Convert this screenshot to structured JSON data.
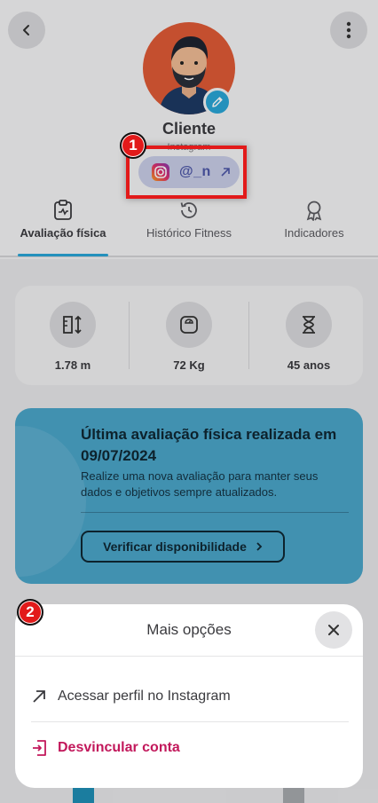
{
  "profile": {
    "name": "Cliente",
    "instagram_caption": "Instagram",
    "instagram_handle": "@_n"
  },
  "tabs": [
    {
      "label": "Avaliação física",
      "icon": "clipboard-icon",
      "active": true
    },
    {
      "label": "Histórico Fitness",
      "icon": "history-icon",
      "active": false
    },
    {
      "label": "Indicadores",
      "icon": "award-icon",
      "active": false
    }
  ],
  "stats": [
    {
      "value": "1.78 m",
      "icon": "height-icon"
    },
    {
      "value": "72 Kg",
      "icon": "scale-icon"
    },
    {
      "value": "45 anos",
      "icon": "hourglass-icon"
    }
  ],
  "evaluation": {
    "title": "Última avaliação física realizada em  09/07/2024",
    "description": "Realize uma nova avaliação para manter seus dados e objetivos sempre atualizados.",
    "button_label": "Verificar disponibilidade"
  },
  "annotations": {
    "marker_1": "1",
    "marker_2": "2"
  },
  "sheet": {
    "title": "Mais opções",
    "items": [
      {
        "label": "Acessar perfil no Instagram",
        "icon": "arrow-up-right-icon"
      },
      {
        "label": "Desvincular conta",
        "icon": "logout-icon"
      }
    ]
  },
  "colors": {
    "accent": "#2aa5d6",
    "danger": "#c2185b",
    "annotation": "#e21a1a",
    "card": "#4aa5c9"
  }
}
